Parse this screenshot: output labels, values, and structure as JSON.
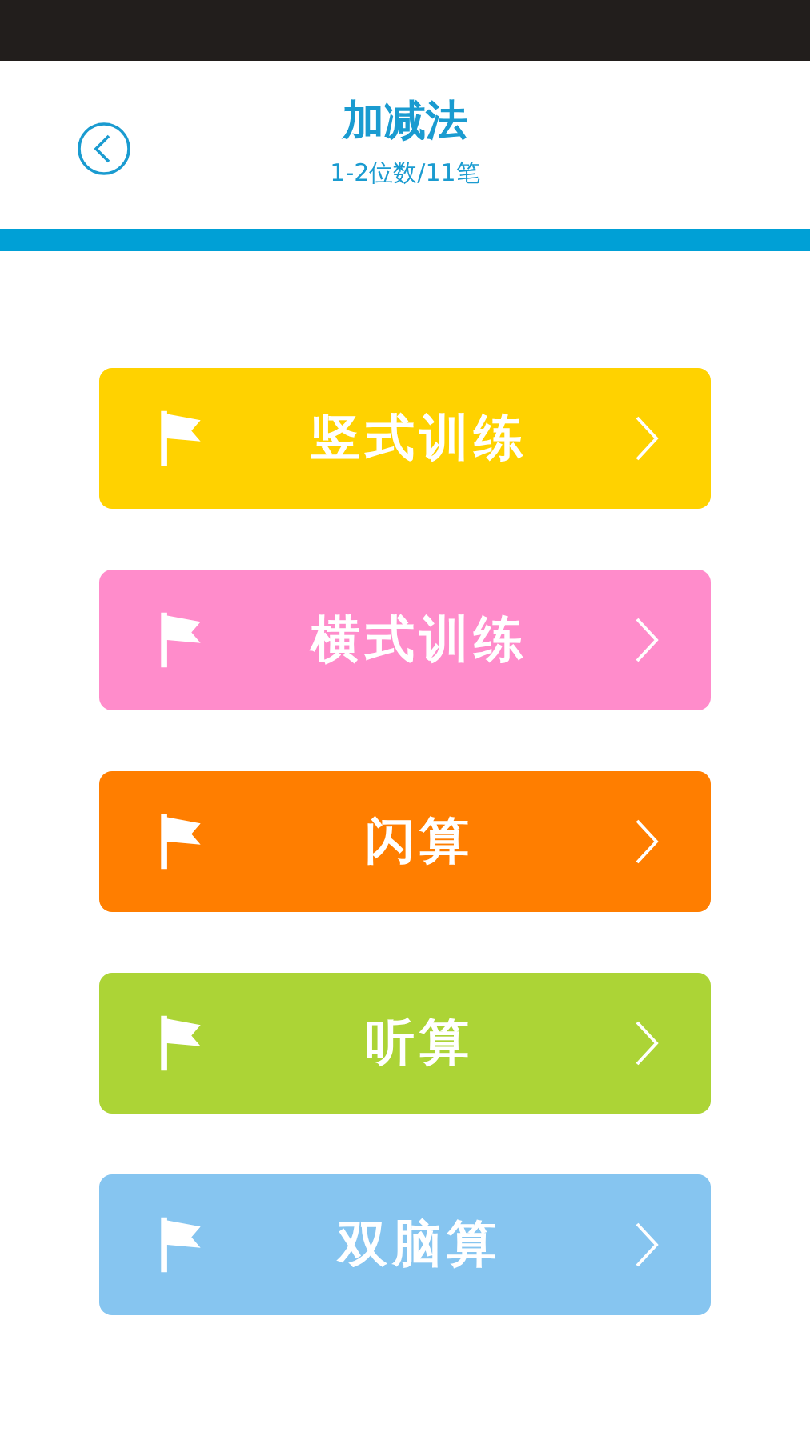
{
  "header": {
    "title": "加减法",
    "subtitle": "1-2位数/11笔"
  },
  "menu": [
    {
      "label": "竖式训练",
      "color": "#ffd200"
    },
    {
      "label": "横式训练",
      "color": "#ff8ccb"
    },
    {
      "label": "闪算",
      "color": "#ff7e00"
    },
    {
      "label": "听算",
      "color": "#acd436"
    },
    {
      "label": "双脑算",
      "color": "#86c5f0"
    }
  ]
}
